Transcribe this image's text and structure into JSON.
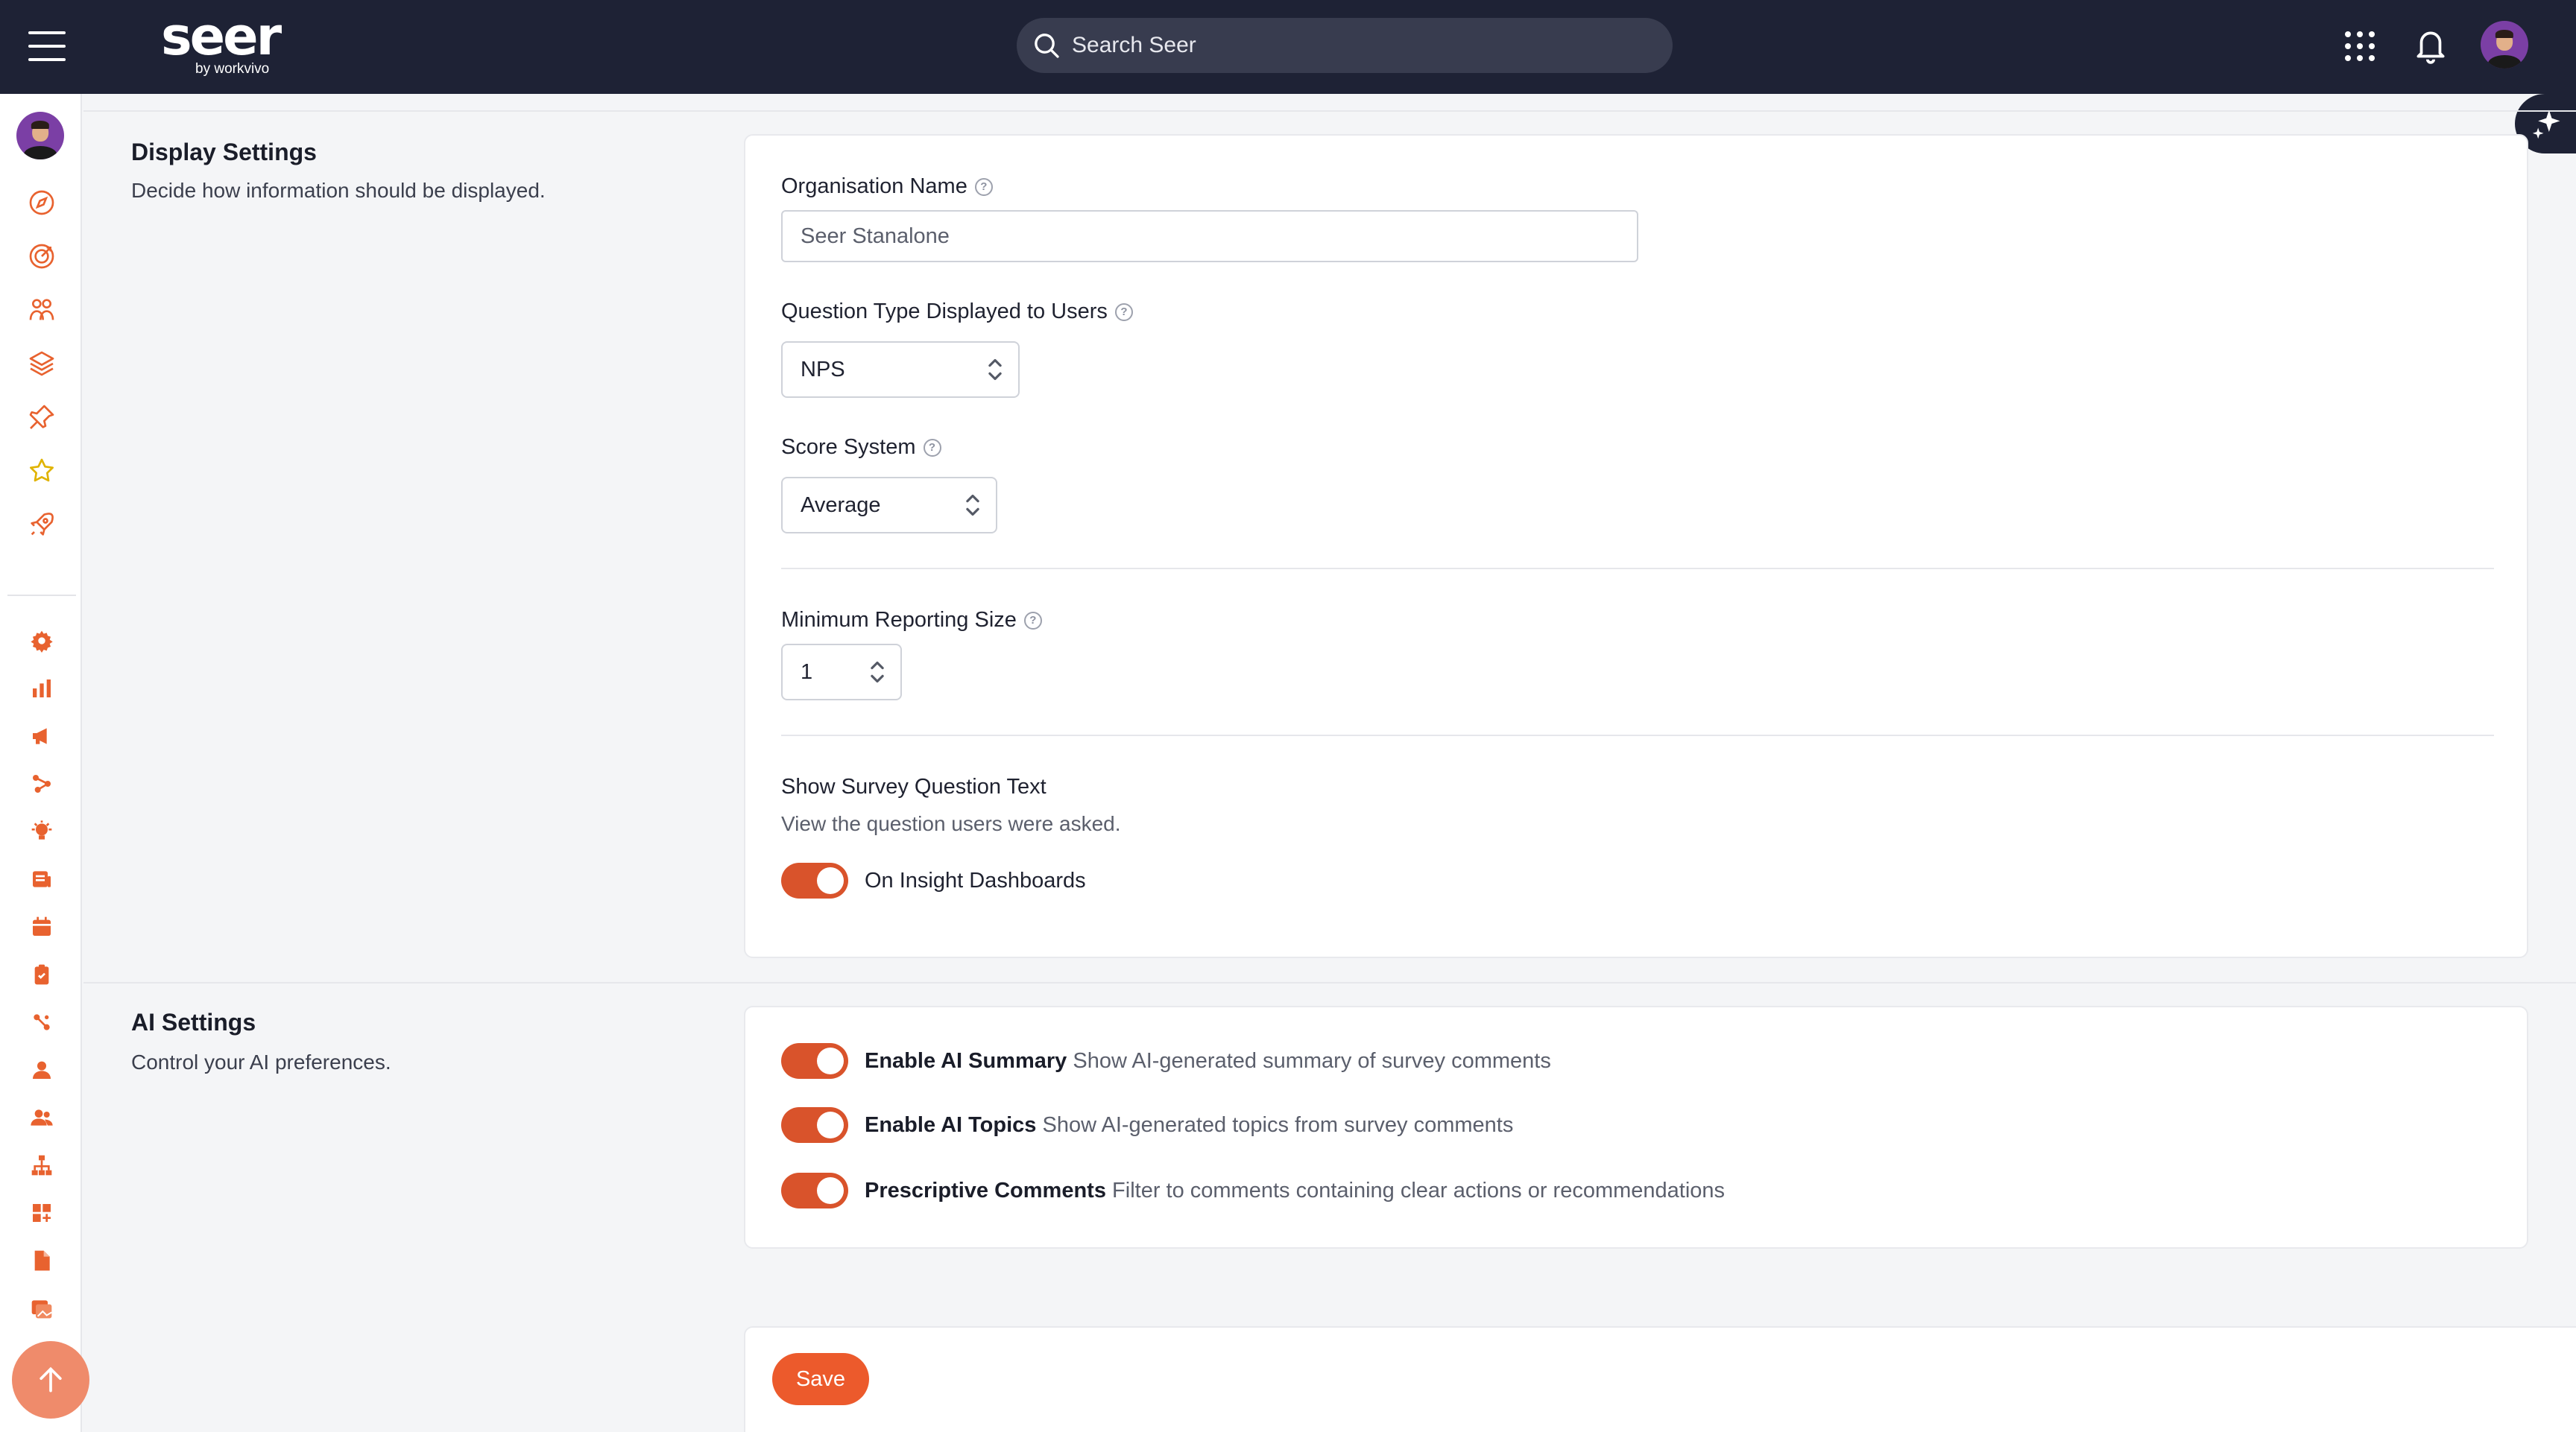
{
  "header": {
    "brand_name": "seer",
    "brand_sub": "by workvivo",
    "search_placeholder": "Search Seer",
    "icons": [
      "menu-icon",
      "search-icon",
      "apps-grid-icon",
      "bell-icon",
      "avatar"
    ]
  },
  "sidebar": {
    "top_icons": [
      "compass-icon",
      "target-icon",
      "people-icon",
      "layers-icon",
      "pin-icon",
      "star-icon",
      "rocket-icon"
    ],
    "bottom_icons": [
      "gear-icon",
      "bar-chart-icon",
      "megaphone-icon",
      "share-icon",
      "bulb-icon",
      "news-icon",
      "calendar-icon",
      "clipboard-icon",
      "link-icon",
      "user-icon",
      "users-icon",
      "hierarchy-icon",
      "widgets-icon",
      "document-icon",
      "gallery-icon"
    ],
    "accent": "#e8622f"
  },
  "display_settings": {
    "title": "Display Settings",
    "description": "Decide how information should be displayed.",
    "org_name_label": "Organisation Name",
    "org_name_placeholder": "Seer Stanalone",
    "question_type_label": "Question Type Displayed to Users",
    "question_type_value": "NPS",
    "score_system_label": "Score System",
    "score_system_value": "Average",
    "min_reporting_label": "Minimum Reporting Size",
    "min_reporting_value": "1",
    "show_question_title": "Show Survey Question Text",
    "show_question_desc": "View the question users were asked.",
    "insight_toggle_label": "On Insight Dashboards",
    "insight_toggle_on": true
  },
  "ai_settings": {
    "title": "AI Settings",
    "description": "Control your AI preferences.",
    "toggles": [
      {
        "label": "Enable AI Summary",
        "desc": "Show AI-generated summary of survey comments",
        "on": true
      },
      {
        "label": "Enable AI Topics",
        "desc": "Show AI-generated topics from survey comments",
        "on": true
      },
      {
        "label": "Prescriptive Comments",
        "desc": "Filter to comments containing clear actions or recommendations",
        "on": true
      }
    ]
  },
  "footer": {
    "save_label": "Save"
  },
  "colors": {
    "topbar": "#1e2235",
    "toggle_on": "#d9532b",
    "save": "#ec5a2c"
  }
}
